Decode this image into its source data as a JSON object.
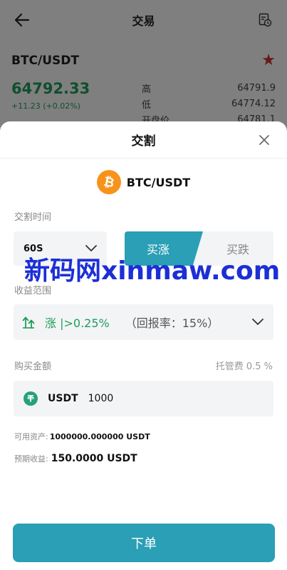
{
  "background_page": {
    "title": "交易",
    "pair": "BTC/USDT",
    "price": "64792.33",
    "change": "+11.23 (+0.02%)",
    "stats": [
      {
        "label": "高",
        "value": "64791.9"
      },
      {
        "label": "低",
        "value": "64774.12"
      },
      {
        "label": "开盘价",
        "value": "64781.1"
      }
    ]
  },
  "sheet": {
    "title": "交割",
    "coin": "BTC/USDT",
    "time_label": "交割时间",
    "time_value": "60S",
    "up_label": "买涨",
    "down_label": "买跌",
    "range_label": "收益范围",
    "range_text": "涨 |>0.25%",
    "range_rate": "（回报率：15%）",
    "amount_label": "购买金额",
    "fee_text": "托管费 0.5 %",
    "amount_unit": "USDT",
    "amount_value": "1000",
    "available_label": "可用资产:",
    "available_value": "1000000.000000 USDT",
    "profit_label": "预期收益:",
    "profit_value": "150.0000 USDT",
    "submit_label": "下单"
  },
  "watermark": "新码网xinmaw.com",
  "colors": {
    "accent": "#2a9fb5",
    "up_green": "#1e9e5a",
    "btc_orange": "#f7931a",
    "usdt_green": "#26a17b",
    "favorite_red": "#d32f2f"
  },
  "icons": {
    "back": "back-arrow-icon",
    "record": "order-record-icon",
    "favorite": "star-icon",
    "close": "close-icon",
    "coin": "bitcoin-icon",
    "range": "arrow-up-trend-icon",
    "dropdown": "chevron-down-icon",
    "usdt": "tether-icon"
  }
}
